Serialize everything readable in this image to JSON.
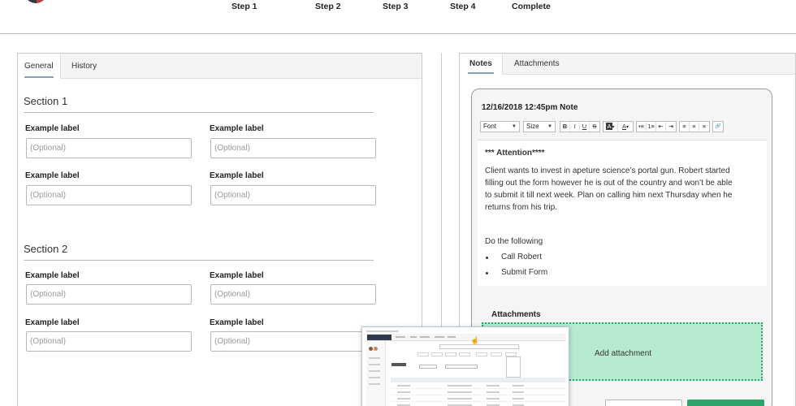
{
  "stepper": {
    "steps": [
      "Step 1",
      "Step 2",
      "Step 3",
      "Step 4",
      "Complete"
    ]
  },
  "left_panel": {
    "tabs": [
      "General",
      "History"
    ],
    "section1": {
      "title": "Section 1",
      "fields": [
        {
          "label": "Example label",
          "placeholder": "(Optional)"
        },
        {
          "label": "Example label",
          "placeholder": "(Optional)"
        },
        {
          "label": "Example label",
          "placeholder": "(Optional)"
        },
        {
          "label": "Example label",
          "placeholder": "(Optional)"
        }
      ]
    },
    "section2": {
      "title": "Section 2",
      "fields": [
        {
          "label": "Example label",
          "placeholder": "(Optional)"
        },
        {
          "label": "Example label",
          "placeholder": "(Optional)"
        },
        {
          "label": "Example label",
          "placeholder": "(Optional)"
        },
        {
          "label": "Example label",
          "placeholder": "(Optional)"
        }
      ]
    }
  },
  "right_panel": {
    "tabs": [
      "Notes",
      "Attachments"
    ],
    "note": {
      "title": "12/16/2018 12:45pm Note",
      "toolbar": {
        "font_label": "Font",
        "size_label": "Size",
        "format_buttons": [
          "B",
          "I",
          "U",
          "S"
        ],
        "color_buttons": [
          "A",
          "A"
        ],
        "list_buttons": [
          "•≡",
          "1≡",
          "⇤",
          "⇥"
        ],
        "align_buttons": [
          "≡",
          "≡",
          "≡"
        ],
        "link_button": "🔗"
      },
      "heading": "*** Attention****",
      "body": "Client wants to invest in apeture science’s portal gun. Robert started filling out the form however he is out of the country and won’t be able to submit it till next week. Plan on calling him next Thursday when he returns from his trip.",
      "list_intro": "Do the following",
      "bullets": [
        "Call Robert",
        "Submit Form"
      ]
    },
    "attachments": {
      "label": "Attachments",
      "dropzone_text": "Add attachment"
    }
  },
  "colors": {
    "dropzone_bg": "#b7ebd0",
    "dropzone_border": "#2ea36a",
    "tab_underline": "#8aa0b6"
  }
}
